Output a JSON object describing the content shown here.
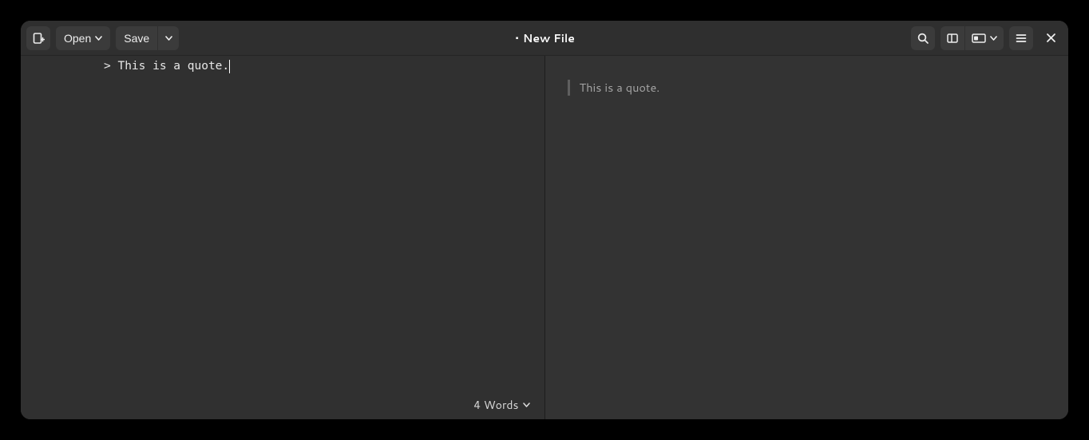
{
  "header": {
    "open_label": "Open",
    "save_label": "Save",
    "modified_indicator": "•",
    "title": "New File"
  },
  "editor": {
    "text": "> This is a quote."
  },
  "preview": {
    "quote_text": "This is a quote."
  },
  "statusbar": {
    "word_count_label": "4 Words"
  }
}
